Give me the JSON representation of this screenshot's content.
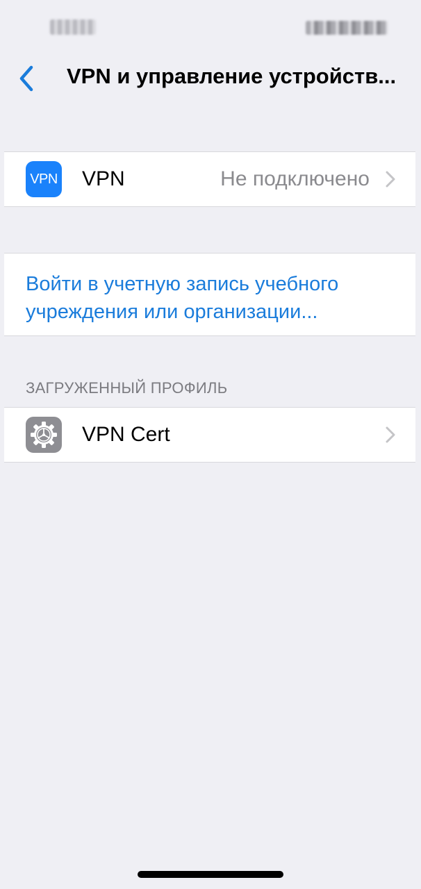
{
  "nav": {
    "title": "VPN и управление устройств..."
  },
  "vpn_row": {
    "icon_text": "VPN",
    "label": "VPN",
    "value": "Не подключено"
  },
  "signin": {
    "text": "Войти в учетную запись учебного учреждения или организации..."
  },
  "profiles": {
    "section_header": "ЗАГРУЖЕННЫЙ ПРОФИЛЬ",
    "items": [
      {
        "label": "VPN Cert",
        "icon": "gear-icon"
      }
    ]
  },
  "colors": {
    "accent": "#1a7cdb",
    "vpn_icon_bg": "#1a82fb",
    "background": "#efeff4",
    "secondary_text": "#8a8a8e"
  }
}
